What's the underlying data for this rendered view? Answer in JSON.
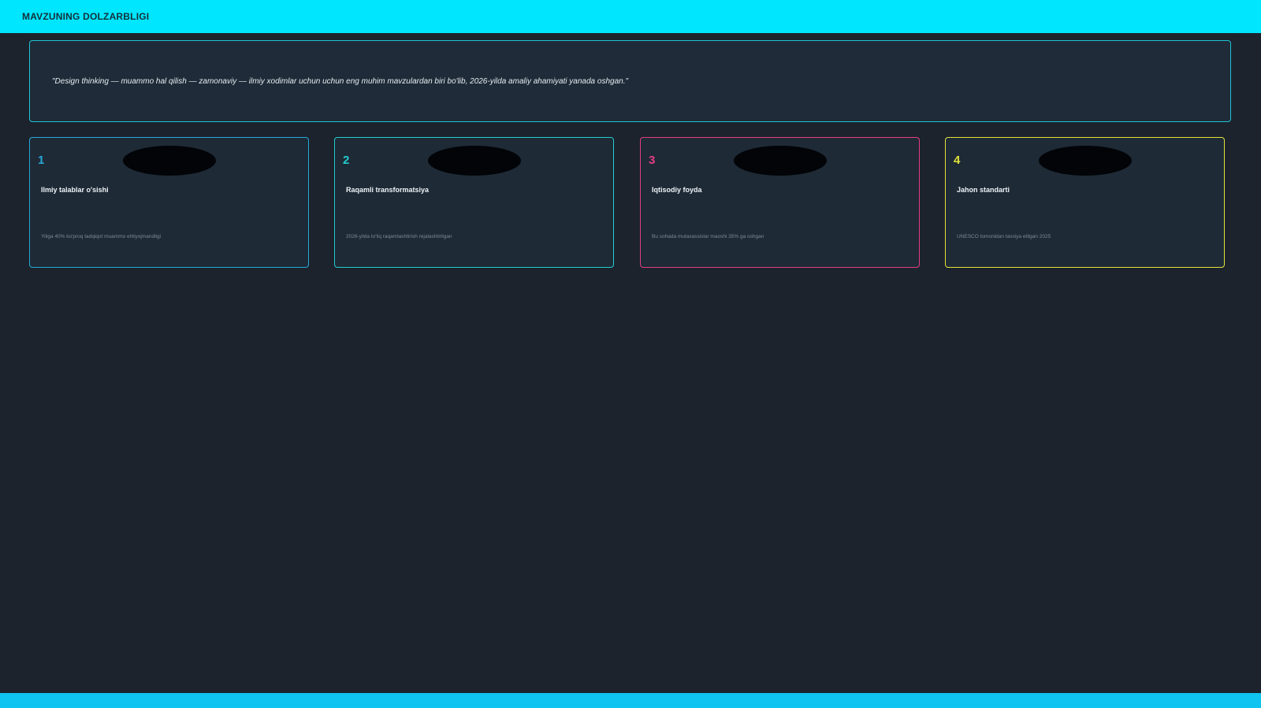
{
  "header": {
    "title": "MAVZUNING DOLZARBLIGI"
  },
  "quote": {
    "text": "\"Design thinking — muammo hal qilish — zamonaviy — ilmiy xodimlar uchun uchun eng muhim mavzulardan biri bo'lib, 2026-yilda amaliy ahamiyati yanada oshgan.\""
  },
  "cards": [
    {
      "number": "1",
      "title": "Ilmiy talablar o'sishi",
      "description": "Yiliga 40% ko'proq tadqiqot muammo ehtiyojmandligi",
      "color": "#27a9d8"
    },
    {
      "number": "2",
      "title": "Raqamli transformatsiya",
      "description": "2026-yilda to'liq raqamlashtirish rejalashtirilgan",
      "color": "#24cdd0"
    },
    {
      "number": "3",
      "title": "Iqtisodiy foyda",
      "description": "Bu sohada mutaxassislar maoshi 35% ga oshgan",
      "color": "#e53d83"
    },
    {
      "number": "4",
      "title": "Jahon standarti",
      "description": "UNESCO tomonidan tavsiya etilgan 2025",
      "color": "#e3e13a"
    }
  ],
  "colors": {
    "header_bg": "#00e6ff",
    "page_bg": "#1c232d",
    "footer_bg": "#10c4f2"
  }
}
